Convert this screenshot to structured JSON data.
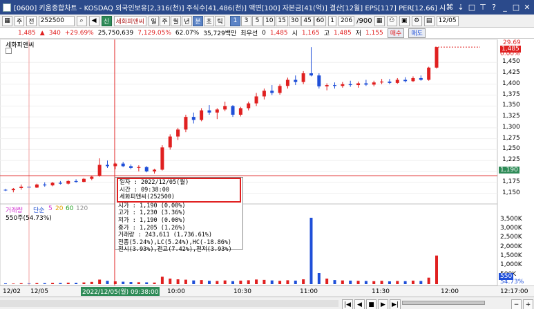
{
  "window": {
    "title": "[0600] 키움종합차트 - KOSDAQ 외국인보유[2,316(천)] 주식수[41,486(천)] 액면[100] 자본금[41(억)] 결산[12월] EPS[117] PER[12.66] 시가총액[616(억"
  },
  "toolbar": {
    "prefix": "주",
    "code_prefix": "전",
    "code": "252500",
    "stock_tag": "신",
    "stock_name": "세화피앤씨",
    "periods": [
      "일",
      "주",
      "월",
      "년",
      "분",
      "초",
      "틱"
    ],
    "selected_period": "분",
    "minutes": [
      "1",
      "3",
      "5",
      "10",
      "15",
      "30",
      "45",
      "60"
    ],
    "selected_minute": "1",
    "count_select": "1",
    "count": "206",
    "count_total": "/900",
    "date": "12/05"
  },
  "quote": {
    "price": "1,485",
    "change": "340",
    "change_pct": "+29.69%",
    "volume": "25,750,639",
    "vol_pct": "7,129.05%",
    "turnover": "62.07%",
    "amount": "35,729백만",
    "priority_label": "최우선",
    "priority_value": "0",
    "p2": "1,485",
    "open_label": "시",
    "open": "1,165",
    "high_label": "고",
    "high": "1,485",
    "low_label": "저",
    "low": "1,155",
    "buy_label": "매수",
    "sell_label": "매도"
  },
  "panel": {
    "name": "세화피앤씨",
    "volume_label": "거래량",
    "ma_label": "단순",
    "ma_values": [
      "5",
      "20",
      "60",
      "120"
    ],
    "vol_note": "550주(54.73%)"
  },
  "price_axis": {
    "ticks": [
      "1,450",
      "1,425",
      "1,400",
      "1,375",
      "1,350",
      "1,325",
      "1,300",
      "1,275",
      "1,250",
      "1,225",
      "1,200",
      "1,175",
      "1,150"
    ],
    "current_label": "1,485",
    "pct_top": "29.69",
    "pct_bottom": "0.00%",
    "cross_label": "1,190"
  },
  "volume_axis": {
    "ticks": [
      "3,500K",
      "3,000K",
      "2,500K",
      "2,000K",
      "1,500K",
      "1,000K",
      "500K"
    ],
    "current_label": "550",
    "pct_label": "54.73%"
  },
  "time_axis": {
    "left_dates": [
      "12/02",
      "12/05"
    ],
    "cursor_label": "2022/12/05(월) 09:38:00",
    "ticks": [
      "10:00",
      "10:30",
      "11:00",
      "11:30",
      "12:00"
    ],
    "right_clock": "12:17:00"
  },
  "tooltip": {
    "rows": [
      "일자    : 2022/12/05(월)",
      "시간    : 09:38:00",
      "세화피앤씨(252500)"
    ],
    "rows2": [
      "시가    : 1,190 (0.00%)",
      "고가    : 1,230 (3.36%)",
      "저가    : 1,190 (0.00%)",
      "종가    : 1,205 (1.26%)",
      "거래량  : 243,611 (1,736.61%)",
      "전종(5.24%),LC(5.24%),HC(-18.86%)",
      "전시(3.93%),전고(7.42%),전저(3.93%)"
    ]
  },
  "chart_data": {
    "type": "candlestick",
    "price_ylim": [
      1135,
      1490
    ],
    "volume_ylim": [
      0,
      3900
    ],
    "candles": [
      [
        1158,
        1160,
        1155,
        1157
      ],
      [
        1157,
        1162,
        1152,
        1160
      ],
      [
        1162,
        1170,
        1158,
        1165
      ],
      [
        1165,
        1168,
        1160,
        1163
      ],
      [
        1163,
        1172,
        1162,
        1170
      ],
      [
        1170,
        1175,
        1165,
        1168
      ],
      [
        1168,
        1176,
        1166,
        1174
      ],
      [
        1174,
        1178,
        1170,
        1172
      ],
      [
        1172,
        1180,
        1170,
        1178
      ],
      [
        1178,
        1182,
        1174,
        1176
      ],
      [
        1176,
        1185,
        1175,
        1183
      ],
      [
        1183,
        1190,
        1180,
        1188
      ],
      [
        1190,
        1230,
        1188,
        1215
      ],
      [
        1215,
        1225,
        1208,
        1212
      ],
      [
        1212,
        1220,
        1205,
        1218
      ],
      [
        1218,
        1222,
        1210,
        1212
      ],
      [
        1212,
        1216,
        1205,
        1208
      ],
      [
        1208,
        1214,
        1200,
        1210
      ],
      [
        1210,
        1212,
        1198,
        1200
      ],
      [
        1200,
        1206,
        1195,
        1204
      ],
      [
        1204,
        1260,
        1202,
        1255
      ],
      [
        1255,
        1285,
        1250,
        1280
      ],
      [
        1280,
        1300,
        1272,
        1296
      ],
      [
        1296,
        1330,
        1290,
        1325
      ],
      [
        1325,
        1335,
        1310,
        1318
      ],
      [
        1318,
        1345,
        1315,
        1340
      ],
      [
        1340,
        1352,
        1330,
        1335
      ],
      [
        1335,
        1345,
        1320,
        1342
      ],
      [
        1342,
        1360,
        1338,
        1350
      ],
      [
        1350,
        1352,
        1325,
        1330
      ],
      [
        1330,
        1348,
        1326,
        1345
      ],
      [
        1345,
        1360,
        1340,
        1356
      ],
      [
        1356,
        1380,
        1350,
        1372
      ],
      [
        1372,
        1390,
        1365,
        1385
      ],
      [
        1385,
        1398,
        1375,
        1380
      ],
      [
        1380,
        1400,
        1376,
        1396
      ],
      [
        1396,
        1415,
        1390,
        1410
      ],
      [
        1410,
        1420,
        1398,
        1405
      ],
      [
        1405,
        1430,
        1400,
        1425
      ],
      [
        1425,
        1485,
        1418,
        1420
      ],
      [
        1420,
        1425,
        1390,
        1395
      ],
      [
        1395,
        1402,
        1386,
        1398
      ],
      [
        1398,
        1404,
        1390,
        1396
      ],
      [
        1396,
        1405,
        1392,
        1400
      ],
      [
        1400,
        1408,
        1394,
        1398
      ],
      [
        1398,
        1406,
        1392,
        1402
      ],
      [
        1402,
        1410,
        1396,
        1399
      ],
      [
        1399,
        1408,
        1395,
        1404
      ],
      [
        1404,
        1412,
        1400,
        1406
      ],
      [
        1406,
        1412,
        1400,
        1403
      ],
      [
        1403,
        1414,
        1401,
        1410
      ],
      [
        1410,
        1416,
        1404,
        1407
      ],
      [
        1407,
        1418,
        1405,
        1414
      ],
      [
        1414,
        1420,
        1408,
        1410
      ],
      [
        1410,
        1440,
        1408,
        1438
      ],
      [
        1438,
        1485,
        1436,
        1485
      ]
    ],
    "volumes": [
      40,
      30,
      50,
      45,
      60,
      55,
      70,
      65,
      80,
      75,
      90,
      120,
      244,
      180,
      150,
      130,
      110,
      100,
      95,
      85,
      400,
      300,
      260,
      240,
      200,
      220,
      180,
      170,
      200,
      160,
      190,
      210,
      250,
      230,
      200,
      180,
      210,
      190,
      260,
      3600,
      600,
      300,
      220,
      200,
      190,
      180,
      170,
      160,
      180,
      150,
      170,
      160,
      190,
      170,
      350,
      1550
    ]
  }
}
